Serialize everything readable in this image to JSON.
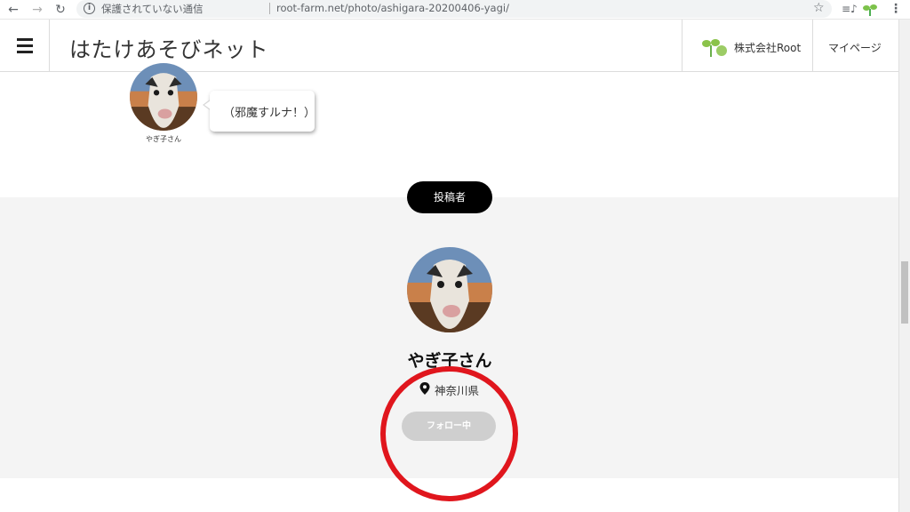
{
  "browser": {
    "security_text": "保護されていない通信",
    "url": "root-farm.net/photo/ashigara-20200406-yagi/",
    "icons": [
      "back-icon",
      "forward-icon",
      "reload-icon",
      "info-icon",
      "star-icon",
      "playlist-icon",
      "extension-sprout-icon",
      "more-vert-icon"
    ]
  },
  "header": {
    "site_title": "はたけあそびネット",
    "company_label": "株式会社Root",
    "mypage_label": "マイページ"
  },
  "comment": {
    "author": "やぎ子さん",
    "text": "（邪魔すルナ！）"
  },
  "poster": {
    "section_label": "投稿者",
    "name": "やぎ子さん",
    "location": "神奈川県",
    "follow_label": "フォロー中"
  },
  "colors": {
    "annotation_circle": "#e0161d",
    "poster_tag_bg": "#000000",
    "follow_button_bg": "#cfcfcf",
    "section_bg": "#f4f4f4"
  }
}
